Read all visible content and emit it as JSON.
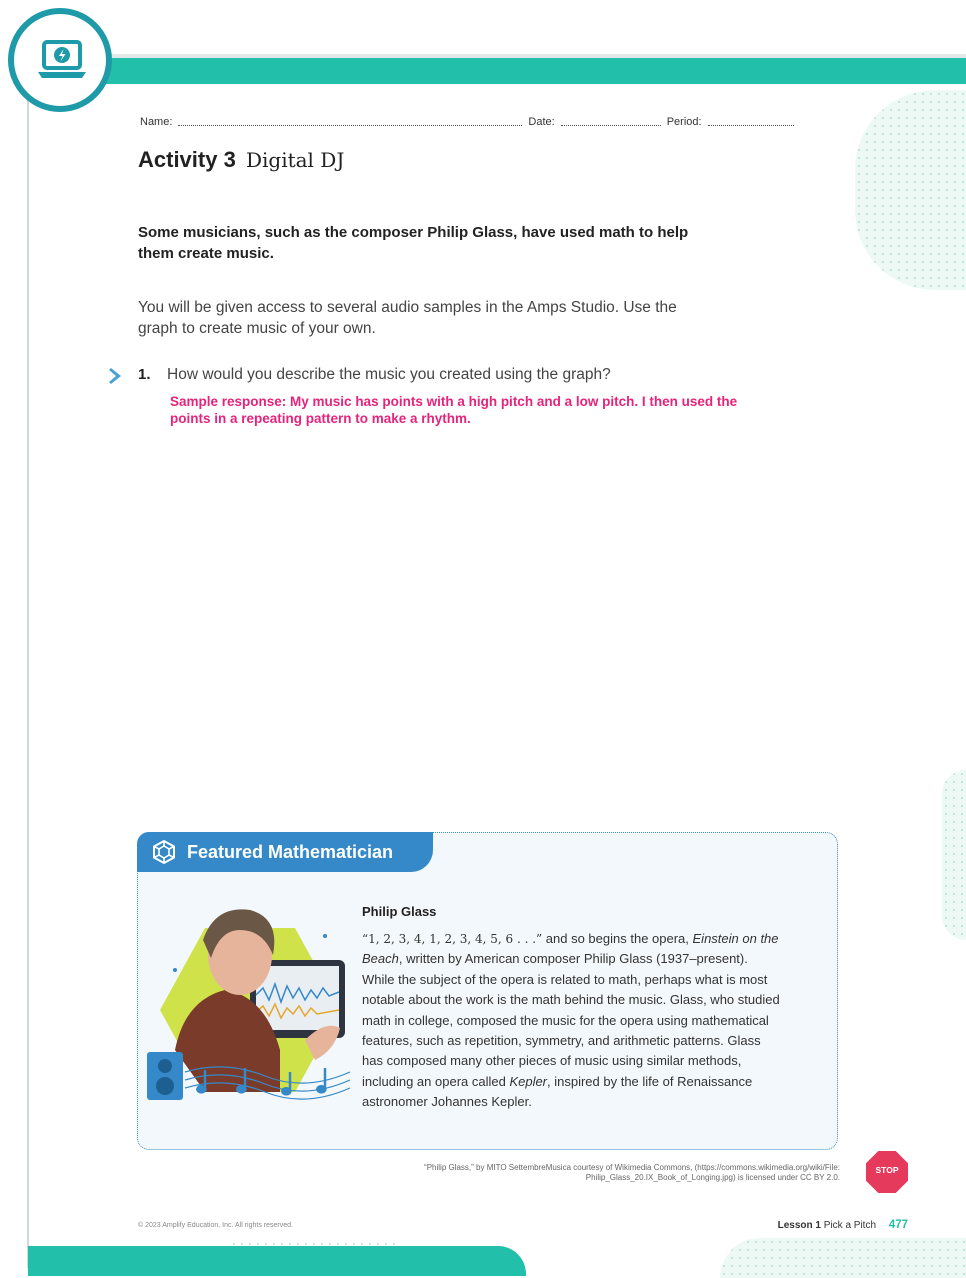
{
  "header": {
    "name_label": "Name:",
    "date_label": "Date:",
    "period_label": "Period:"
  },
  "activity": {
    "number": "Activity 3",
    "title": "Digital DJ"
  },
  "intro": {
    "bold": "Some musicians, such as the composer Philip Glass, have used math to help them create music.",
    "text": "You will be given access to several audio samples in the Amps Studio. Use the graph to create music of your own."
  },
  "question": {
    "number": "1.",
    "text": "How would you describe the music you created using the graph?",
    "answer": "Sample response: My music has points with a high pitch and a low pitch. I then used the points in a repeating pattern to make a rhythm."
  },
  "featured": {
    "tab_label": "Featured Mathematician",
    "name": "Philip Glass",
    "body_seq": "“1, 2, 3, 4, 1, 2, 3, 4, 5, 6 . . .”",
    "body_1": " and so begins the opera, ",
    "body_opera": "Einstein on the Beach",
    "body_2": ", written by American composer Philip Glass (1937–present). While the subject of the opera is related to math, perhaps what is most notable about the work is the math behind the music. Glass, who studied math in college, composed the music for the opera using mathematical features, such as repetition, symmetry, and arithmetic patterns. Glass has composed many other pieces of music using similar methods, including an opera called ",
    "body_kepler": "Kepler",
    "body_3": ", inspired by the life of Renaissance astronomer Johannes Kepler."
  },
  "credit": {
    "line1": "“Philip Glass,” by MITO SettembreMusica courtesy of Wikimedia Commons, (https://commons.wikimedia.org/wiki/File:",
    "line2": "Philip_Glass_20.IX_Book_of_Longing.jpg) is licensed under CC BY 2.0."
  },
  "stop_label": "STOP",
  "footer": {
    "copyright": "© 2023 Amplify Education, Inc. All rights reserved.",
    "lesson_label": "Lesson 1",
    "lesson_title": "Pick a Pitch",
    "page_number": "477"
  },
  "colors": {
    "teal": "#22bfaa",
    "badge_ring": "#1e9aa8",
    "featured_blue": "#3589c8",
    "answer_pink": "#e6247b",
    "stop_red": "#e63a5c"
  },
  "icons": {
    "badge": "laptop-lightning-icon",
    "question_marker": "chevron-right-icon",
    "featured": "geodesic-sphere-icon",
    "stop": "stop-sign-icon"
  }
}
